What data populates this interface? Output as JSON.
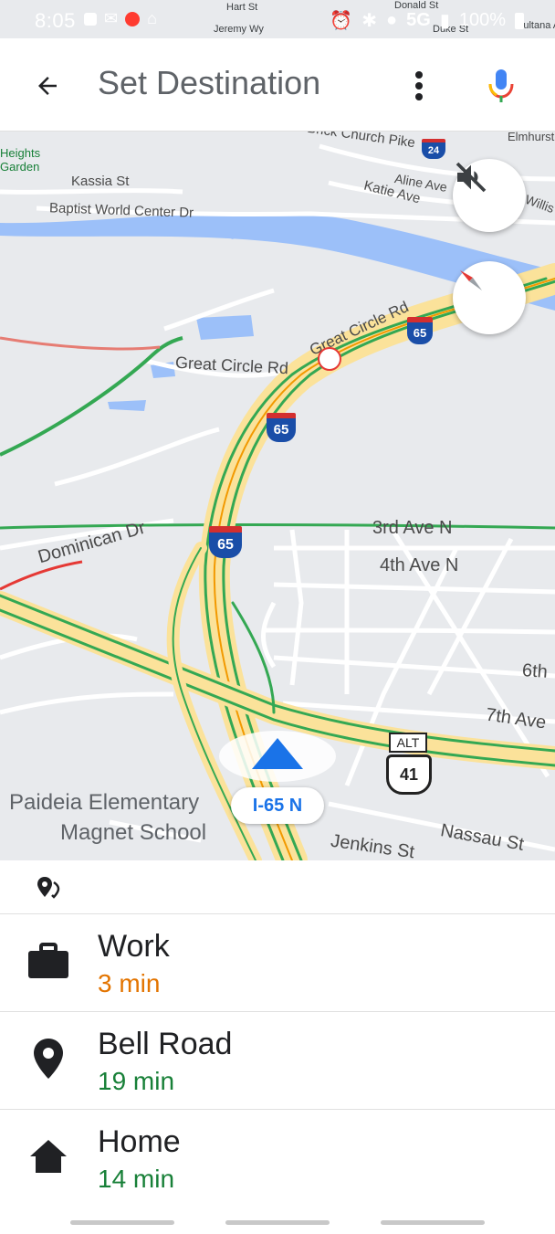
{
  "status": {
    "time": "8:05",
    "network": "5G",
    "battery": "100%"
  },
  "header": {
    "title": "Set Destination"
  },
  "map": {
    "labels": {
      "elm_hill": "Heights Garden",
      "kassia": "Kassia St",
      "baptist": "Baptist World Center Dr",
      "brick_church": "Brick Church Pike",
      "aline": "Aline Ave",
      "katie": "Katie Ave",
      "willis": "Willis",
      "great_circle_1": "Great Circle Rd",
      "great_circle_2": "Great Circle Rd",
      "dominican": "Dominican Dr",
      "ave3": "3rd Ave N",
      "ave4": "4th Ave N",
      "ave6": "6th",
      "ave7": "7th Ave",
      "paideia1": "Paideia Elementary",
      "paideia2": "Magnet School",
      "nassau": "Nassau St",
      "jenkins": "Jenkins St",
      "hart": "Hart St",
      "donald": "Donald St",
      "duke": "Duke St",
      "jeremy": "Jeremy Wy",
      "elmhurst": "Elmhurst",
      "sultana": "Sultana A"
    },
    "shields": {
      "i65_a": "65",
      "i65_b": "65",
      "i65_c": "65",
      "i24": "24",
      "us41": "41",
      "alt": "ALT"
    },
    "current_road": "I-65 N"
  },
  "destinations": [
    {
      "name": "Work",
      "eta": "3 min",
      "eta_color": "#e37400",
      "icon": "briefcase-icon"
    },
    {
      "name": "Bell Road",
      "eta": "19 min",
      "eta_color": "#188038",
      "icon": "location-pin-icon"
    },
    {
      "name": "Home",
      "eta": "14 min",
      "eta_color": "#188038",
      "icon": "home-icon"
    }
  ],
  "colors": {
    "accent_blue": "#1a73e8",
    "traffic_green": "#34a853",
    "traffic_orange": "#f29900",
    "river": "#9cc0f9"
  }
}
